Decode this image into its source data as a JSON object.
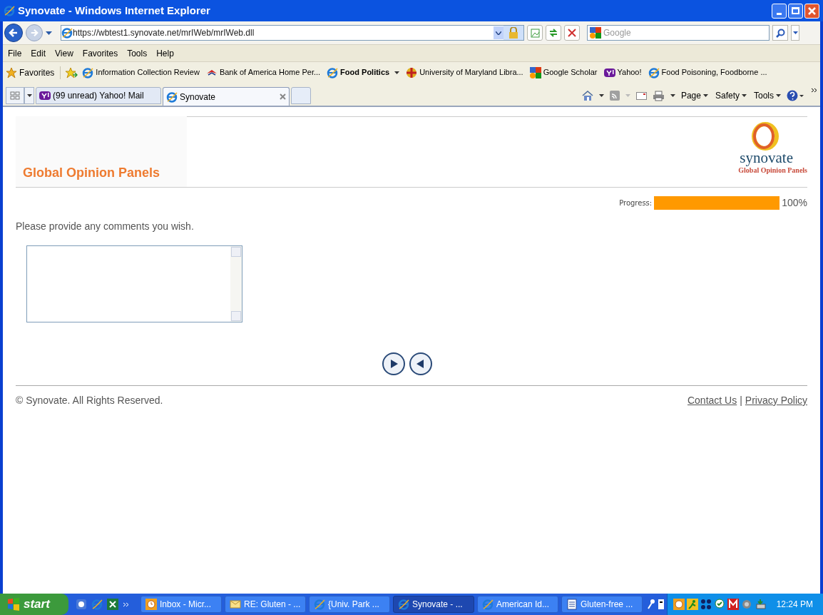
{
  "window": {
    "title": "Synovate - Windows Internet Explorer"
  },
  "address_bar": {
    "url": "https://wbtest1.synovate.net/mrIWeb/mrIWeb.dll"
  },
  "search": {
    "placeholder": "Google"
  },
  "menu": [
    "File",
    "Edit",
    "View",
    "Favorites",
    "Tools",
    "Help"
  ],
  "favorites_bar": {
    "label": "Favorites",
    "links": [
      {
        "label": "Information Collection Review",
        "bold": false
      },
      {
        "label": "Bank of America  Home  Per...",
        "bold": false
      },
      {
        "label": "Food Politics",
        "bold": true
      },
      {
        "label": "University of Maryland Libra...",
        "bold": false
      },
      {
        "label": "Google Scholar",
        "bold": false
      },
      {
        "label": "Yahoo!",
        "bold": false
      },
      {
        "label": "Food Poisoning, Foodborne ...",
        "bold": false
      }
    ]
  },
  "tabs": [
    {
      "label": "(99 unread) Yahoo! Mail",
      "selected": false
    },
    {
      "label": "Synovate",
      "selected": true
    }
  ],
  "command_bar": [
    "Page",
    "Safety",
    "Tools"
  ],
  "page": {
    "brand_title": "Global Opinion Panels",
    "logo": {
      "wordmark": "synovate",
      "tagline": "Global Opinion Panels"
    },
    "progress": {
      "label": "Progress:",
      "level": 1,
      "reading": "100%"
    },
    "question": "Please provide any comments you wish.",
    "footer": {
      "copyright": "© Synovate. All Rights Reserved.",
      "links": [
        "Contact Us",
        "Privacy Policy"
      ],
      "separator": "|"
    }
  },
  "taskbar": {
    "start": "start",
    "tasks": [
      {
        "label": "Inbox - Micr...",
        "selected": false
      },
      {
        "label": "RE: Gluten - ...",
        "selected": false
      },
      {
        "label": "{Univ. Park ...",
        "selected": false
      },
      {
        "label": "Synovate - ...",
        "selected": true
      },
      {
        "label": "American Id...",
        "selected": false
      },
      {
        "label": "Gluten-free ...",
        "selected": false
      }
    ],
    "clock": "12:24 PM"
  }
}
